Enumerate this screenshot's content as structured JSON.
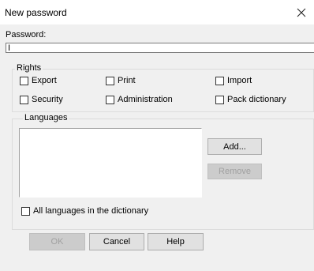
{
  "window": {
    "title": "New password",
    "close_icon": "close-icon"
  },
  "password": {
    "label": "Password:",
    "value": "I"
  },
  "rights": {
    "caption": "Rights",
    "options": [
      {
        "label": "Export",
        "checked": false
      },
      {
        "label": "Print",
        "checked": false
      },
      {
        "label": "Import",
        "checked": false
      },
      {
        "label": "Security",
        "checked": false
      },
      {
        "label": "Administration",
        "checked": false
      },
      {
        "label": "Pack dictionary",
        "checked": false
      }
    ]
  },
  "languages": {
    "caption": "Languages",
    "items": [],
    "add_label": "Add...",
    "remove_label": "Remove",
    "all_languages_label": "All languages in the dictionary",
    "all_languages_checked": false
  },
  "buttons": {
    "ok": "OK",
    "cancel": "Cancel",
    "help": "Help"
  }
}
